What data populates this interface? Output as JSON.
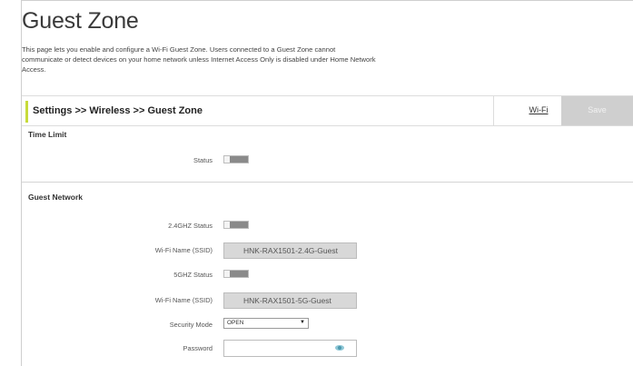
{
  "page": {
    "title": "Guest Zone",
    "description": "This page lets you enable and configure a Wi-Fi Guest Zone. Users connected to a Guest Zone cannot communicate or detect devices on your home network unless Internet Access Only is disabled under Home Network Access."
  },
  "header": {
    "breadcrumb": "Settings >> Wireless >> Guest Zone",
    "wifi_label": "Wi-Fi",
    "save_label": "Save",
    "accent_color": "#c7db3a"
  },
  "time_limit": {
    "title": "Time Limit",
    "status_label": "Status",
    "status_on": false
  },
  "guest_network": {
    "title": "Guest Network",
    "ghz24_status_label": "2.4GHZ Status",
    "ghz24_status_on": false,
    "ssid24_label": "Wi-Fi Name (SSID)",
    "ssid24_value": "HNK-RAX1501-2.4G-Guest",
    "ghz5_status_label": "5GHZ Status",
    "ghz5_status_on": false,
    "ssid5_label": "Wi-Fi Name (SSID)",
    "ssid5_value": "HNK-RAX1501-5G-Guest",
    "security_label": "Security Mode",
    "security_value": "OPEN",
    "password_label": "Password",
    "password_value": ""
  }
}
